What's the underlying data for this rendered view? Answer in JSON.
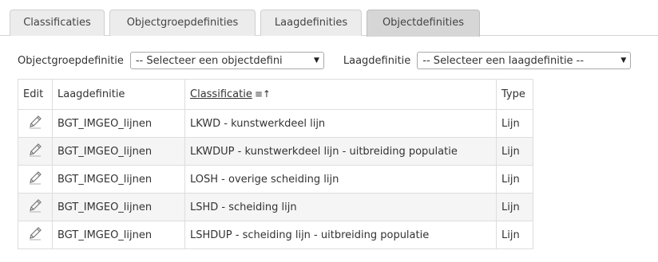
{
  "tabs": [
    {
      "label": "Classificaties",
      "active": false
    },
    {
      "label": "Objectgroepdefinities",
      "active": false
    },
    {
      "label": "Laagdefinities",
      "active": false
    },
    {
      "label": "Objectdefinities",
      "active": true
    }
  ],
  "filters": {
    "objectgroep_label": "Objectgroepdefinitie",
    "objectgroep_value": "-- Selecteer een objectdefini",
    "laag_label": "Laagdefinitie",
    "laag_value": "-- Selecteer een laagdefinitie --"
  },
  "table": {
    "headers": {
      "edit": "Edit",
      "laag": "Laagdefinitie",
      "classificatie": "Classificatie",
      "type": "Type"
    },
    "sort_icon": "sort-ascending-icon",
    "edit_icon": "pencil-edit-icon",
    "rows": [
      {
        "laag": "BGT_IMGEO_lijnen",
        "classificatie": "LKWD - kunstwerkdeel lijn",
        "type": "Lijn"
      },
      {
        "laag": "BGT_IMGEO_lijnen",
        "classificatie": "LKWDUP - kunstwerkdeel lijn - uitbreiding populatie",
        "type": "Lijn"
      },
      {
        "laag": "BGT_IMGEO_lijnen",
        "classificatie": "LOSH - overige scheiding lijn",
        "type": "Lijn"
      },
      {
        "laag": "BGT_IMGEO_lijnen",
        "classificatie": "LSHD - scheiding lijn",
        "type": "Lijn"
      },
      {
        "laag": "BGT_IMGEO_lijnen",
        "classificatie": "LSHDUP - scheiding lijn - uitbreiding populatie",
        "type": "Lijn"
      }
    ]
  }
}
